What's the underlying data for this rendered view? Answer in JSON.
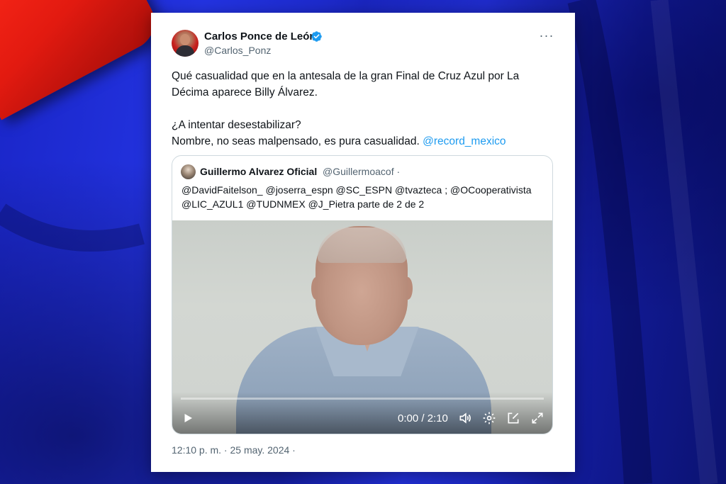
{
  "tweet": {
    "author_name": "Carlos Ponce de León",
    "author_handle": "@Carlos_Ponz",
    "more_label": "···",
    "text_line1": "Qué casualidad que en la antesala de la gran Final de Cruz Azul por La Décima aparece Billy Álvarez.",
    "text_line2": "¿A intentar desestabilizar?",
    "text_line3": "Nombre, no seas malpensado, es pura casualidad.",
    "text_mention": "@record_mexico",
    "timestamp": "12:10 p. m. · 25 may. 2024 ·"
  },
  "quote": {
    "author_name": "Guillermo Alvarez Oficial",
    "author_handle": "@Guillermoacof ·",
    "text": "@DavidFaitelson_ @joserra_espn @SC_ESPN @tvazteca ; @OCooperativista @LIC_AZUL1 @TUDNMEX @J_Pietra parte de 2 de 2"
  },
  "video": {
    "time": "0:00 / 2:10",
    "progress_fraction": 0,
    "icons": [
      "play-icon",
      "volume-icon",
      "settings-icon",
      "picture-in-picture-icon",
      "fullscreen-icon"
    ]
  },
  "colors": {
    "link": "#1d9bf0",
    "verified": "#1d9bf0",
    "background_blue": "#1f2fd8",
    "corner_red": "#e21a10"
  }
}
